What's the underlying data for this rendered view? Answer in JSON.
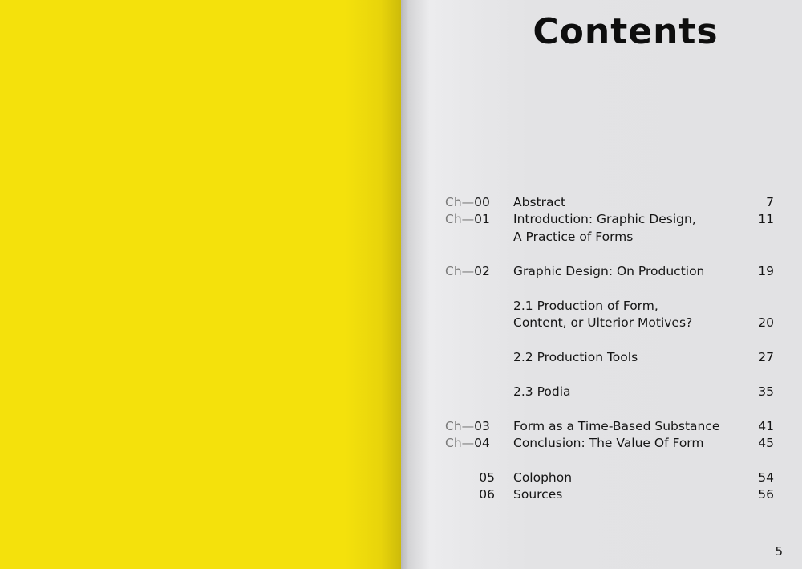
{
  "title": "Contents",
  "page_number": "5",
  "toc": [
    {
      "prefix": "Ch—",
      "num": "00",
      "title": "Abstract",
      "page": "7"
    },
    {
      "prefix": "Ch—",
      "num": "01",
      "title": "Introduction: Graphic Design,",
      "title2": "A Practice of Forms",
      "page": "11"
    },
    {
      "prefix": "Ch—",
      "num": "02",
      "title": "Graphic Design: On Production",
      "page": "19"
    },
    {
      "title": "2.1 Production of Form,",
      "title2": "Content, or Ulterior Motives?",
      "page": "20"
    },
    {
      "title": "2.2 Production Tools",
      "page": "27"
    },
    {
      "title": "2.3 Podia",
      "page": "35"
    },
    {
      "prefix": "Ch—",
      "num": "03",
      "title": "Form as a Time-Based Substance",
      "page": "41"
    },
    {
      "prefix": "Ch—",
      "num": "04",
      "title": "Conclusion: The Value Of Form",
      "page": "45"
    },
    {
      "num": "05",
      "title": "Colophon",
      "page": "54"
    },
    {
      "num": "06",
      "title": "Sources",
      "page": "56"
    }
  ],
  "colors": {
    "cover_yellow": "#f4e10c",
    "paper": "#e3e3e5",
    "chapter_prefix": "#7a7a7a",
    "text": "#151515"
  }
}
